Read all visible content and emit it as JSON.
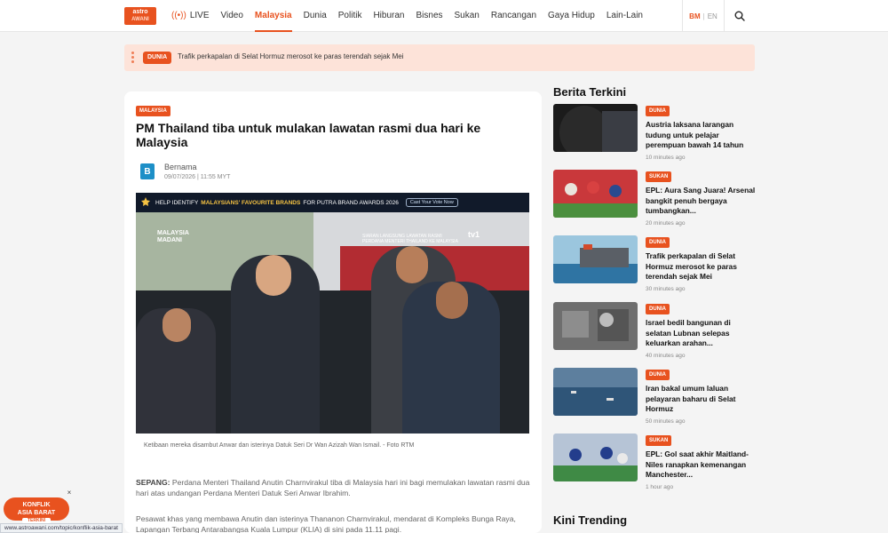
{
  "brand": {
    "line1": "astro",
    "line2": "AWANI"
  },
  "nav": {
    "live_label": "LIVE",
    "items": [
      "Video",
      "Malaysia",
      "Dunia",
      "Politik",
      "Hiburan",
      "Bisnes",
      "Sukan",
      "Rancangan",
      "Gaya Hidup",
      "Lain-Lain"
    ],
    "active": "Malaysia"
  },
  "lang": {
    "bm": "BM",
    "sep": "|",
    "en": "EN"
  },
  "ticker": {
    "tag": "DUNIA",
    "text": "Trafik perkapalan di Selat Hormuz merosot ke paras terendah sejak Mei"
  },
  "article": {
    "tag": "MALAYSIA",
    "title": "PM Thailand tiba untuk mulakan lawatan rasmi dua hari ke Malaysia",
    "author": "Bernama",
    "date": "09/07/2026 | 11:55 MYT",
    "image": {
      "banner_pre": "HELP IDENTIFY",
      "banner_hl": "MALAYSIANS' FAVOURITE BRANDS",
      "banner_post": "FOR PUTRA BRAND AWARDS 2026",
      "vote_label": "Cast Your Vote Now",
      "brand_line1": "MALAYSIA",
      "brand_line2": "MADANI",
      "overlay_line1": "SIARAN LANGSUNG LAWATAN RASMI",
      "overlay_line2": "PERDANA MENTERI THAILAND KE MALAYSIA",
      "channel": "tv1"
    },
    "caption": "Ketibaan mereka disambut Anwar dan isterinya Datuk Seri Dr Wan Azizah Wan Ismail. - Foto RTM",
    "para1_lead": "SEPANG:",
    "para1": "Perdana Menteri Thailand Anutin Charnvirakul tiba di Malaysia hari ini bagi memulakan lawatan rasmi dua hari atas undangan Perdana Menteri Datuk Seri Anwar Ibrahim.",
    "para2": "Pesawat khas yang membawa Anutin dan isterinya Thananon Charnvirakul, mendarat di Kompleks Bunga Raya, Lapangan Terbang Antarabangsa Kuala Lumpur (KLIA) di sini pada 11.11 pagi."
  },
  "sidebar": {
    "title": "Berita Terkini",
    "items": [
      {
        "tag": "DUNIA",
        "title": "Austria laksana larangan tudung untuk pelajar perempuan bawah 14 tahun",
        "time": "10 minutes ago"
      },
      {
        "tag": "SUKAN",
        "title": "EPL: Aura Sang Juara! Arsenal bangkit penuh bergaya tumbangkan...",
        "time": "20 minutes ago"
      },
      {
        "tag": "DUNIA",
        "title": "Trafik perkapalan di Selat Hormuz merosot ke paras terendah sejak Mei",
        "time": "30 minutes ago"
      },
      {
        "tag": "DUNIA",
        "title": "Israel bedil bangunan di selatan Lubnan selepas keluarkan arahan...",
        "time": "40 minutes ago"
      },
      {
        "tag": "DUNIA",
        "title": "Iran bakal umum laluan pelayaran baharu di Selat Hormuz",
        "time": "50 minutes ago"
      },
      {
        "tag": "SUKAN",
        "title": "EPL: Gol saat akhir Maitland-Niles ranapkan kemenangan Manchester...",
        "time": "1 hour ago"
      }
    ],
    "trending_title": "Kini Trending"
  },
  "float": {
    "line1": "KONFLIK",
    "line2": "ASIA BARAT",
    "badge": "TERKINI",
    "close": "×"
  },
  "status_url": "www.astroawani.com/topic/konflik-asia-barat"
}
